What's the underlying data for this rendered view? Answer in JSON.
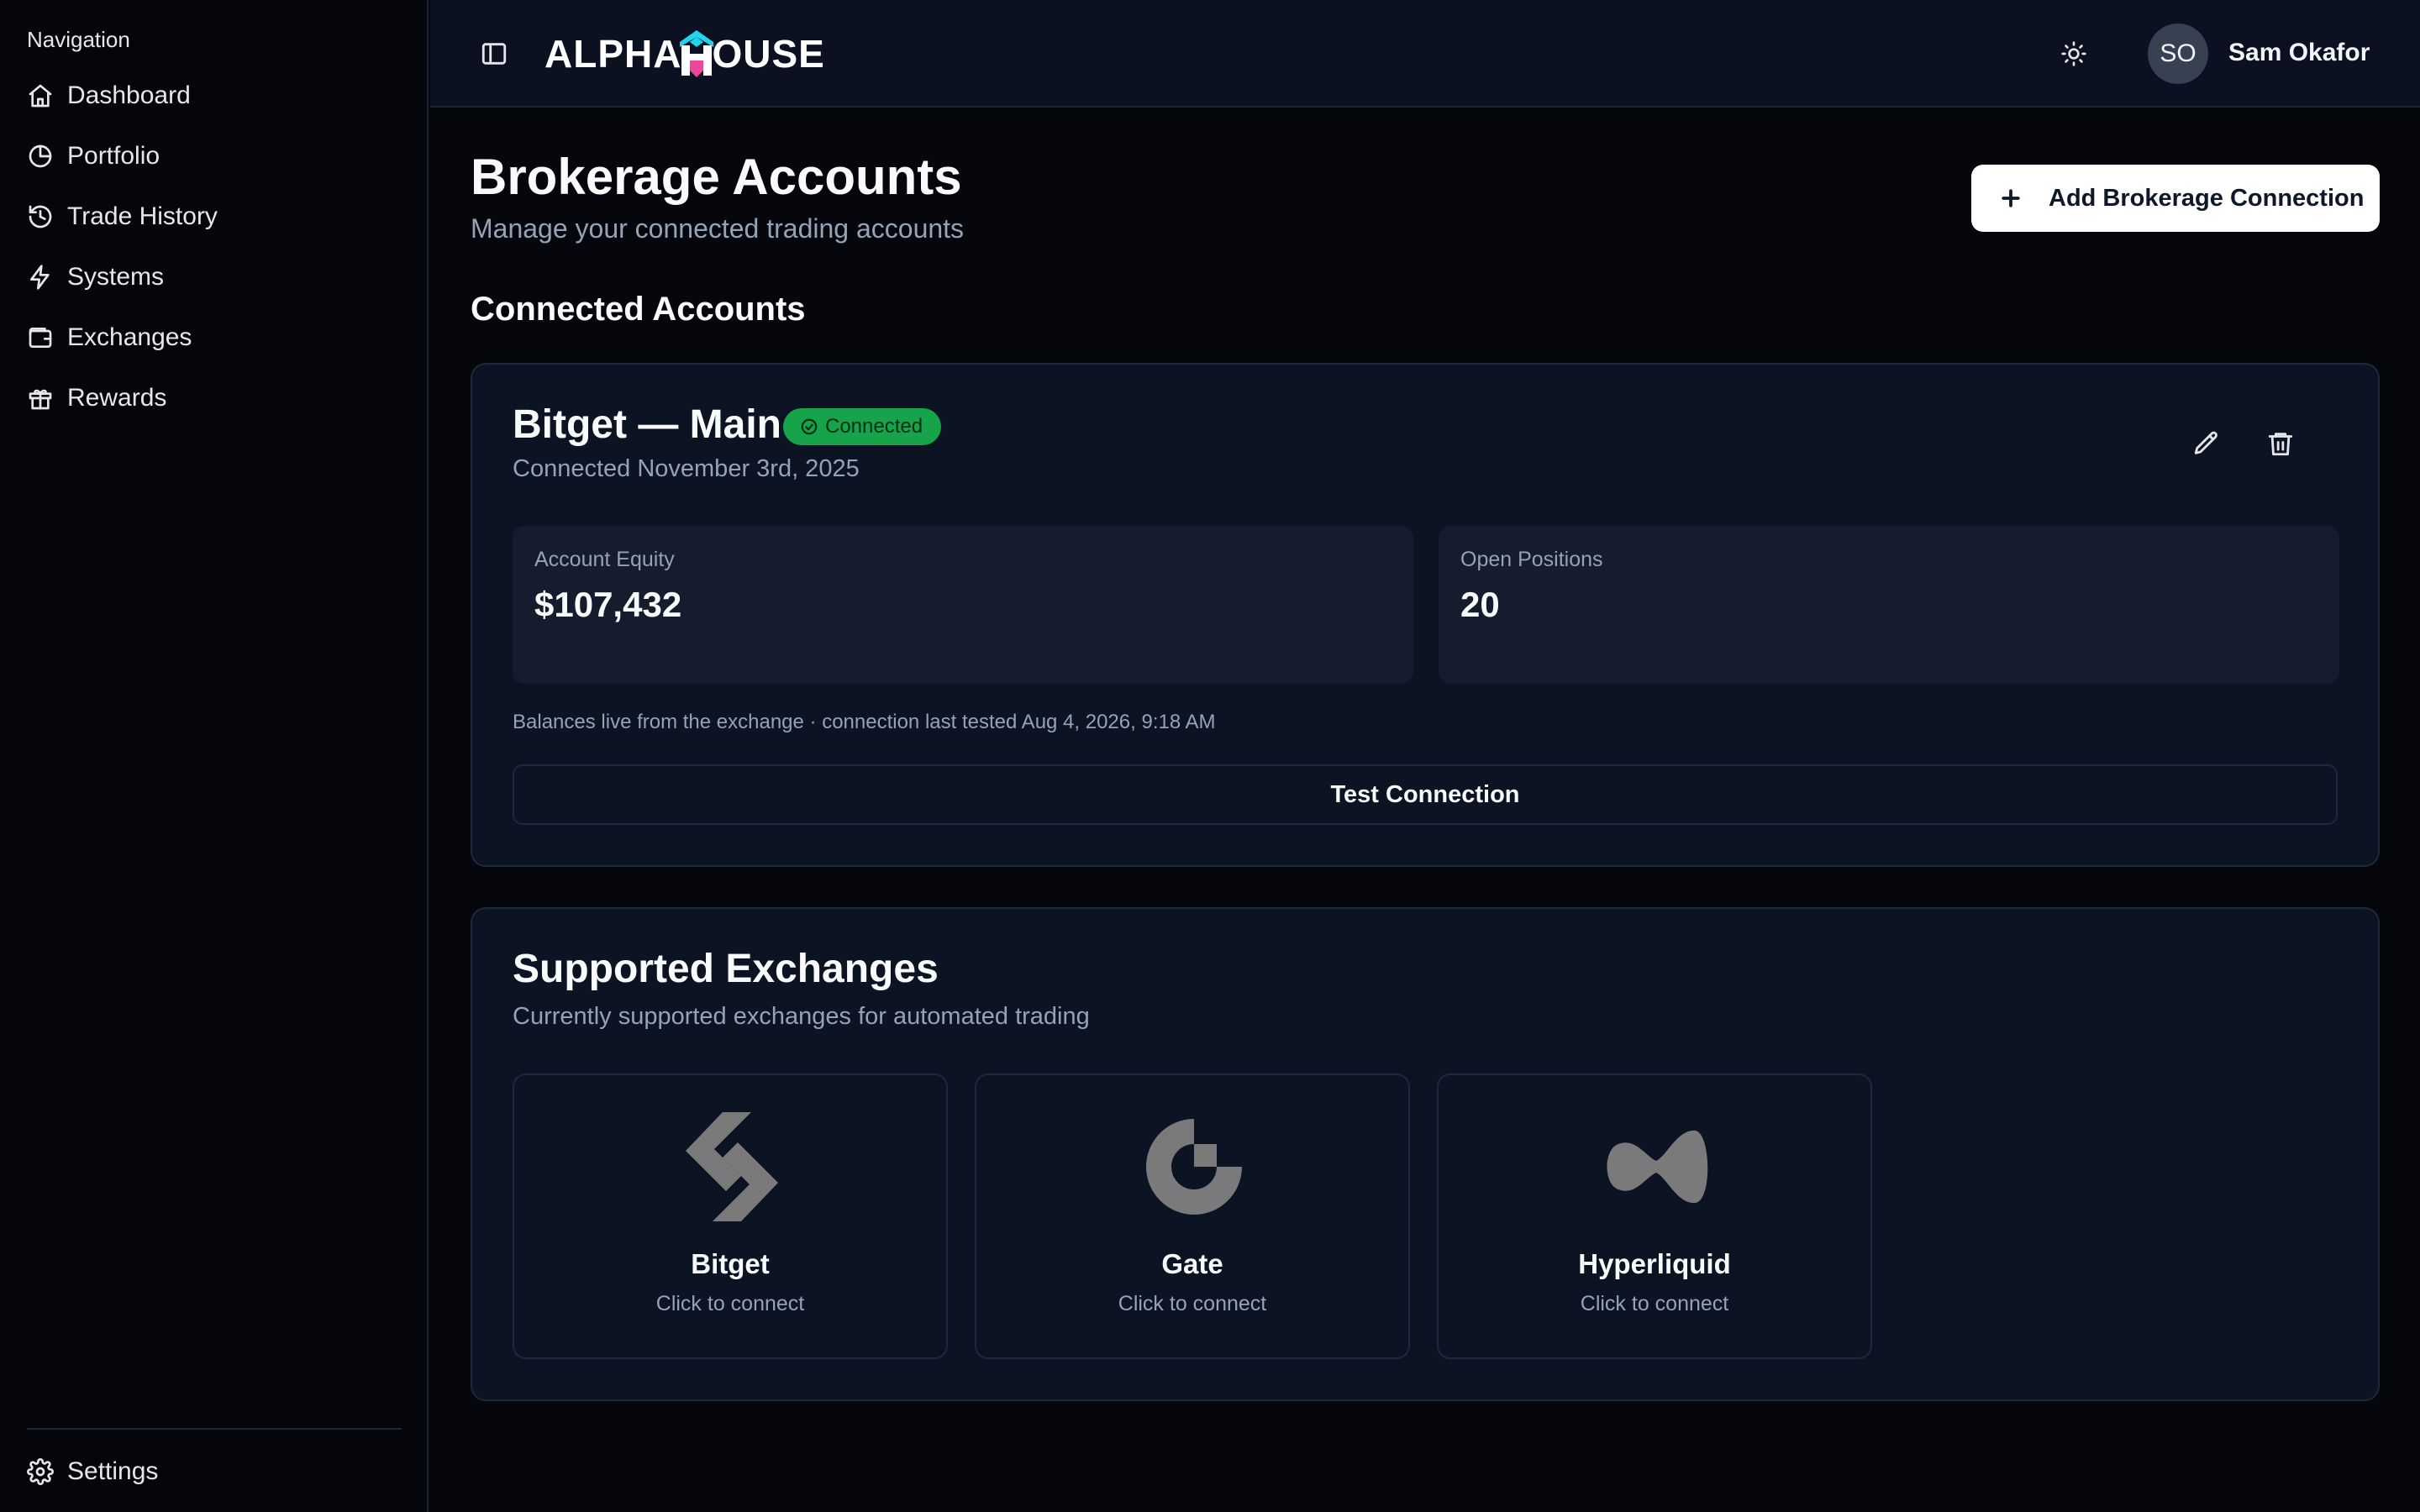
{
  "sidebar": {
    "heading": "Navigation",
    "items": [
      {
        "label": "Dashboard",
        "icon": "home-icon"
      },
      {
        "label": "Portfolio",
        "icon": "pie-chart-icon"
      },
      {
        "label": "Trade History",
        "icon": "history-icon"
      },
      {
        "label": "Systems",
        "icon": "lightning-icon"
      },
      {
        "label": "Exchanges",
        "icon": "wallet-icon"
      },
      {
        "label": "Rewards",
        "icon": "gift-icon"
      }
    ],
    "settings": {
      "label": "Settings",
      "icon": "gear-icon"
    }
  },
  "header": {
    "logo_left": "ALPHA",
    "logo_right": "OUSE",
    "user_initials": "SO",
    "user_name": "Sam Okafor"
  },
  "page": {
    "title": "Brokerage Accounts",
    "subtitle": "Manage your connected trading accounts",
    "add_button": "Add Brokerage Connection"
  },
  "connected": {
    "section_title": "Connected Accounts",
    "account": {
      "name": "Bitget — Main",
      "status": "Connected",
      "connected_date": "Connected November 3rd, 2025",
      "equity_label": "Account Equity",
      "equity_value": "$107,432",
      "positions_label": "Open Positions",
      "positions_value": "20",
      "note": "Balances live from the exchange · connection last tested Aug 4, 2026, 9:18 AM",
      "test_button": "Test Connection"
    }
  },
  "exchanges": {
    "title": "Supported Exchanges",
    "subtitle": "Currently supported exchanges for automated trading",
    "items": [
      {
        "name": "Bitget",
        "hint": "Click to connect"
      },
      {
        "name": "Gate",
        "hint": "Click to connect"
      },
      {
        "name": "Hyperliquid",
        "hint": "Click to connect"
      }
    ]
  },
  "colors": {
    "badge_green": "#16a34a",
    "logo_cyan": "#22d3ee",
    "logo_pink": "#ec4899",
    "exchange_logo_gray": "#7a7a7a"
  }
}
